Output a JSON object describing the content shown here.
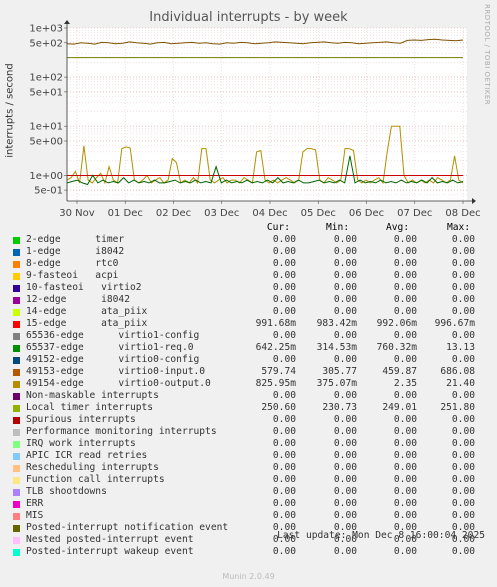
{
  "title": "Individual interrupts - by week",
  "side_label": "RRDTOOL / TOBI OETIKER",
  "last_update": "Last update: Mon Dec  8 16:00:04 2025",
  "footer": "Munin 2.0.49",
  "columns": {
    "cur": "Cur:",
    "min": "Min:",
    "avg": "Avg:",
    "max": "Max:"
  },
  "chart_data": {
    "type": "line",
    "title": "Individual interrupts - by week",
    "ylabel": "interrupts / second",
    "yscale": "log",
    "ylim": [
      0.3,
      1000
    ],
    "yticks": [
      "1e+03",
      "5e+02",
      "1e+02",
      "5e+01",
      "1e+01",
      "5e+00",
      "1e+00",
      "5e-01"
    ],
    "ytick_values": [
      1000,
      500,
      100,
      50,
      10,
      5,
      1,
      0.5
    ],
    "xticks": [
      "30 Nov",
      "01 Dec",
      "02 Dec",
      "03 Dec",
      "04 Dec",
      "05 Dec",
      "06 Dec",
      "07 Dec",
      "08 Dec"
    ],
    "grid": true,
    "series": [
      {
        "name": "49154-edge",
        "color": "#b38f00",
        "description": "spiky series 0.6 to 10",
        "values": [
          0.8,
          0.9,
          1.2,
          0.7,
          4,
          0.8,
          0.7,
          0.9,
          1.1,
          0.7,
          1.5,
          0.8,
          0.7,
          3.5,
          3.8,
          3.6,
          0.8,
          0.7,
          0.8,
          1.0,
          0.7,
          0.8,
          0.9,
          0.7,
          0.8,
          2.2,
          1.8,
          0.7,
          0.8,
          0.7,
          0.9,
          0.7,
          3.5,
          3.5,
          0.8,
          0.7,
          0.8,
          0.9,
          0.7,
          0.8,
          0.8,
          0.7,
          0.9,
          0.8,
          0.7,
          3,
          3.2,
          0.8,
          0.7,
          0.8,
          0.7,
          0.8,
          0.9,
          0.8,
          0.7,
          0.8,
          3,
          3.5,
          3.5,
          3.3,
          0.8,
          0.7,
          0.9,
          0.8,
          0.7,
          0.8,
          3.5,
          3.5,
          3.2,
          0.8,
          0.7,
          0.8,
          0.7,
          0.8,
          0.9,
          0.7,
          3,
          10,
          10,
          10,
          1.0,
          0.7,
          0.8,
          0.7,
          0.8,
          0.7,
          0.8,
          0.7,
          0.9,
          0.8,
          0.7,
          0.8,
          2.5,
          0.8,
          0.7
        ]
      },
      {
        "name": "Local timer interrupts",
        "color": "#787800",
        "description": "flat at about 250",
        "values": [
          250,
          250
        ]
      },
      {
        "name": "65536-edge",
        "color": "#7f5200",
        "description": "around 500",
        "values": [
          480,
          470,
          500,
          490,
          470,
          510,
          500,
          480,
          490,
          520,
          500,
          490,
          470,
          500,
          510,
          480,
          490,
          500,
          510,
          490,
          500,
          480,
          470,
          500,
          490,
          510,
          500,
          480,
          490,
          500,
          520,
          510,
          500,
          490,
          480,
          500,
          510,
          520,
          500,
          490,
          510,
          500,
          480,
          490,
          500,
          510,
          520,
          500,
          490,
          560,
          570,
          560,
          580,
          590,
          570,
          560,
          550,
          570
        ]
      },
      {
        "name": "15-edge",
        "color": "#cc0000",
        "description": "flat at about 1",
        "values": [
          0.99,
          0.99
        ]
      },
      {
        "name": "virtio0-req",
        "color": "#006600",
        "description": "around 0.7 with spikes",
        "values": [
          0.7,
          0.75,
          0.8,
          0.7,
          0.65,
          1.0,
          0.7,
          0.8,
          0.7,
          0.75,
          0.7,
          0.9,
          0.7,
          0.8,
          0.7,
          0.75,
          0.7,
          0.8,
          0.7,
          0.7,
          0.75,
          0.8,
          0.7,
          0.75,
          0.7,
          0.8,
          0.7,
          0.75,
          0.7,
          1.5,
          0.7,
          0.8,
          0.7,
          0.75,
          0.7,
          0.8,
          0.7,
          0.75,
          0.7,
          0.8,
          0.7,
          0.9,
          0.7,
          0.75,
          0.7,
          0.8,
          0.7,
          0.7,
          0.75,
          0.8,
          0.7,
          0.75,
          0.7,
          0.8,
          0.7,
          2.5,
          0.7,
          0.8,
          0.7,
          0.75,
          0.7,
          0.8,
          0.7,
          0.75,
          0.7,
          0.8,
          0.7,
          0.75,
          0.7,
          0.8,
          0.7,
          0.9,
          0.7,
          0.75,
          0.7,
          0.8,
          0.7,
          0.75
        ]
      }
    ]
  },
  "legend": [
    {
      "color": "#00cc00",
      "label": "2-edge      timer",
      "cur": "0.00",
      "min": "0.00",
      "avg": "0.00",
      "max": "0.00"
    },
    {
      "color": "#0066b3",
      "label": "1-edge      i8042",
      "cur": "0.00",
      "min": "0.00",
      "avg": "0.00",
      "max": "0.00"
    },
    {
      "color": "#ff8000",
      "label": "8-edge      rtc0",
      "cur": "0.00",
      "min": "0.00",
      "avg": "0.00",
      "max": "0.00"
    },
    {
      "color": "#ffcc00",
      "label": "9-fasteoi   acpi",
      "cur": "0.00",
      "min": "0.00",
      "avg": "0.00",
      "max": "0.00"
    },
    {
      "color": "#330099",
      "label": "10-fasteoi   virtio2",
      "cur": "0.00",
      "min": "0.00",
      "avg": "0.00",
      "max": "0.00"
    },
    {
      "color": "#990099",
      "label": "12-edge      i8042",
      "cur": "0.00",
      "min": "0.00",
      "avg": "0.00",
      "max": "0.00"
    },
    {
      "color": "#ccff00",
      "label": "14-edge      ata_piix",
      "cur": "0.00",
      "min": "0.00",
      "avg": "0.00",
      "max": "0.00"
    },
    {
      "color": "#ff0000",
      "label": "15-edge      ata_piix",
      "cur": "991.68m",
      "min": "983.42m",
      "avg": "992.06m",
      "max": "996.67m"
    },
    {
      "color": "#808080",
      "label": "65536-edge      virtio1-config",
      "cur": "0.00",
      "min": "0.00",
      "avg": "0.00",
      "max": "0.00"
    },
    {
      "color": "#008f00",
      "label": "65537-edge      virtio1-req.0",
      "cur": "642.25m",
      "min": "314.53m",
      "avg": "760.32m",
      "max": "13.13"
    },
    {
      "color": "#00487d",
      "label": "49152-edge      virtio0-config",
      "cur": "0.00",
      "min": "0.00",
      "avg": "0.00",
      "max": "0.00"
    },
    {
      "color": "#b35a00",
      "label": "49153-edge      virtio0-input.0",
      "cur": "579.74",
      "min": "305.77",
      "avg": "459.87",
      "max": "686.08"
    },
    {
      "color": "#b38f00",
      "label": "49154-edge      virtio0-output.0",
      "cur": "825.95m",
      "min": "375.07m",
      "avg": "2.35",
      "max": "21.40"
    },
    {
      "color": "#6b006b",
      "label": "Non-maskable interrupts",
      "cur": "0.00",
      "min": "0.00",
      "avg": "0.00",
      "max": "0.00"
    },
    {
      "color": "#8fb300",
      "label": "Local timer interrupts",
      "cur": "250.60",
      "min": "230.73",
      "avg": "249.01",
      "max": "251.80"
    },
    {
      "color": "#b30000",
      "label": "Spurious interrupts",
      "cur": "0.00",
      "min": "0.00",
      "avg": "0.00",
      "max": "0.00"
    },
    {
      "color": "#bebebe",
      "label": "Performance monitoring interrupts",
      "cur": "0.00",
      "min": "0.00",
      "avg": "0.00",
      "max": "0.00"
    },
    {
      "color": "#80ff80",
      "label": "IRQ work interrupts",
      "cur": "0.00",
      "min": "0.00",
      "avg": "0.00",
      "max": "0.00"
    },
    {
      "color": "#80c9ff",
      "label": "APIC ICR read retries",
      "cur": "0.00",
      "min": "0.00",
      "avg": "0.00",
      "max": "0.00"
    },
    {
      "color": "#ffc080",
      "label": "Rescheduling interrupts",
      "cur": "0.00",
      "min": "0.00",
      "avg": "0.00",
      "max": "0.00"
    },
    {
      "color": "#ffe680",
      "label": "Function call interrupts",
      "cur": "0.00",
      "min": "0.00",
      "avg": "0.00",
      "max": "0.00"
    },
    {
      "color": "#aa80ff",
      "label": "TLB shootdowns",
      "cur": "0.00",
      "min": "0.00",
      "avg": "0.00",
      "max": "0.00"
    },
    {
      "color": "#ee00cc",
      "label": "ERR",
      "cur": "0.00",
      "min": "0.00",
      "avg": "0.00",
      "max": "0.00"
    },
    {
      "color": "#ff8080",
      "label": "MIS",
      "cur": "0.00",
      "min": "0.00",
      "avg": "0.00",
      "max": "0.00"
    },
    {
      "color": "#666600",
      "label": "Posted-interrupt notification event",
      "cur": "0.00",
      "min": "0.00",
      "avg": "0.00",
      "max": "0.00"
    },
    {
      "color": "#ffbfff",
      "label": "Nested posted-interrupt event",
      "cur": "0.00",
      "min": "0.00",
      "avg": "0.00",
      "max": "0.00"
    },
    {
      "color": "#00ffcc",
      "label": "Posted-interrupt wakeup event",
      "cur": "0.00",
      "min": "0.00",
      "avg": "0.00",
      "max": "0.00"
    }
  ]
}
